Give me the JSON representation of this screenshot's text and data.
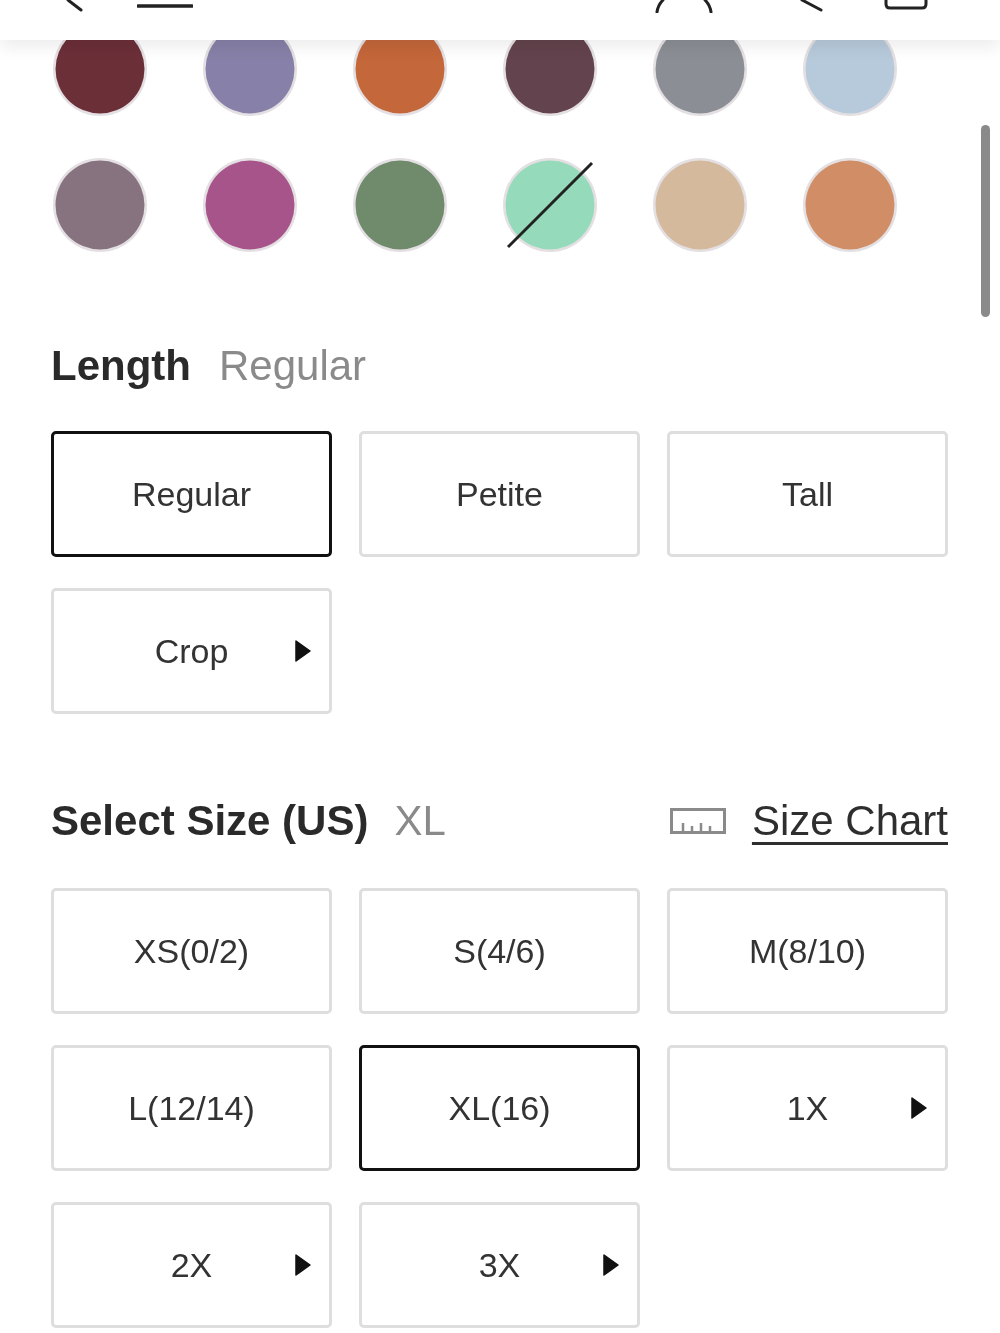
{
  "colors": [
    {
      "color": "#6b2f38",
      "available": true
    },
    {
      "color": "#8780a8",
      "available": true
    },
    {
      "color": "#c4673a",
      "available": true
    },
    {
      "color": "#63434d",
      "available": true
    },
    {
      "color": "#8b8e94",
      "available": true
    },
    {
      "color": "#b7cadb",
      "available": true
    },
    {
      "color": "#86737f",
      "available": true
    },
    {
      "color": "#a7548b",
      "available": true
    },
    {
      "color": "#6f8b6c",
      "available": true
    },
    {
      "color": "#95dbbb",
      "available": false
    },
    {
      "color": "#d4b99c",
      "available": true
    },
    {
      "color": "#d18d65",
      "available": true
    }
  ],
  "length": {
    "title": "Length",
    "value": "Regular",
    "options": [
      {
        "label": "Regular",
        "selected": true,
        "expandable": false
      },
      {
        "label": "Petite",
        "selected": false,
        "expandable": false
      },
      {
        "label": "Tall",
        "selected": false,
        "expandable": false
      },
      {
        "label": "Crop",
        "selected": false,
        "expandable": true
      }
    ]
  },
  "size": {
    "title": "Select Size (US)",
    "value": "XL",
    "chart_link": "Size Chart",
    "options": [
      {
        "label": "XS(0/2)",
        "selected": false,
        "expandable": false
      },
      {
        "label": "S(4/6)",
        "selected": false,
        "expandable": false
      },
      {
        "label": "M(8/10)",
        "selected": false,
        "expandable": false
      },
      {
        "label": "L(12/14)",
        "selected": false,
        "expandable": false
      },
      {
        "label": "XL(16)",
        "selected": true,
        "expandable": false
      },
      {
        "label": "1X",
        "selected": false,
        "expandable": true
      },
      {
        "label": "2X",
        "selected": false,
        "expandable": true
      },
      {
        "label": "3X",
        "selected": false,
        "expandable": true
      }
    ]
  }
}
